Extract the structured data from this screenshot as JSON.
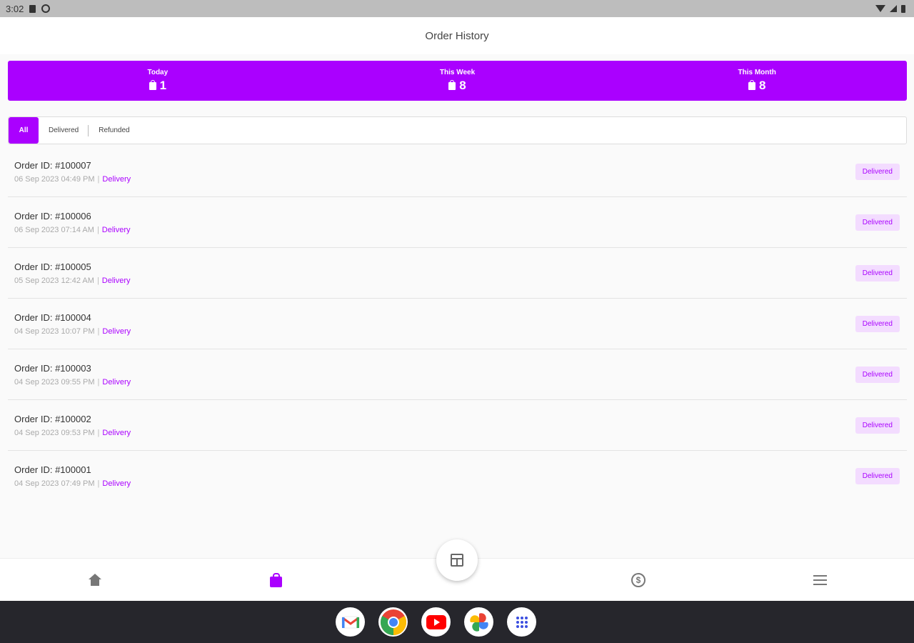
{
  "status_bar": {
    "time": "3:02"
  },
  "header": {
    "title": "Order History"
  },
  "stats": [
    {
      "label": "Today",
      "value": "1"
    },
    {
      "label": "This Week",
      "value": "8"
    },
    {
      "label": "This Month",
      "value": "8"
    }
  ],
  "filters": {
    "tabs": [
      {
        "label": "All",
        "active": true
      },
      {
        "label": "Delivered",
        "active": false
      },
      {
        "label": "Refunded",
        "active": false
      }
    ]
  },
  "orders": [
    {
      "id": "Order ID: #100007",
      "datetime": "06 Sep 2023 04:49 PM",
      "separator": "|",
      "type": "Delivery",
      "status": "Delivered"
    },
    {
      "id": "Order ID: #100006",
      "datetime": "06 Sep 2023 07:14 AM",
      "separator": "|",
      "type": "Delivery",
      "status": "Delivered"
    },
    {
      "id": "Order ID: #100005",
      "datetime": "05 Sep 2023 12:42 AM",
      "separator": "|",
      "type": "Delivery",
      "status": "Delivered"
    },
    {
      "id": "Order ID: #100004",
      "datetime": "04 Sep 2023 10:07 PM",
      "separator": "|",
      "type": "Delivery",
      "status": "Delivered"
    },
    {
      "id": "Order ID: #100003",
      "datetime": "04 Sep 2023 09:55 PM",
      "separator": "|",
      "type": "Delivery",
      "status": "Delivered"
    },
    {
      "id": "Order ID: #100002",
      "datetime": "04 Sep 2023 09:53 PM",
      "separator": "|",
      "type": "Delivery",
      "status": "Delivered"
    },
    {
      "id": "Order ID: #100001",
      "datetime": "04 Sep 2023 07:49 PM",
      "separator": "|",
      "type": "Delivery",
      "status": "Delivered"
    }
  ],
  "bottom_nav": {
    "items": [
      {
        "name": "home",
        "icon": "home-icon"
      },
      {
        "name": "orders",
        "icon": "shopping-bag-icon",
        "active": true
      },
      {
        "name": "store",
        "icon": "store-icon"
      },
      {
        "name": "earnings",
        "icon": "dollar-coin-icon",
        "glyph": "$"
      },
      {
        "name": "menu",
        "icon": "menu-icon"
      }
    ]
  },
  "taskbar": {
    "apps": [
      {
        "name": "gmail",
        "icon": "gmail-icon"
      },
      {
        "name": "chrome",
        "icon": "chrome-icon"
      },
      {
        "name": "youtube",
        "icon": "youtube-icon"
      },
      {
        "name": "photos",
        "icon": "photos-icon"
      },
      {
        "name": "app-drawer",
        "icon": "apps-grid-icon"
      }
    ]
  },
  "colors": {
    "accent": "#aa00ff",
    "badge_bg": "#f3dcff",
    "taskbar_bg": "#26262c",
    "status_bar_bg": "#bdbdbd"
  }
}
